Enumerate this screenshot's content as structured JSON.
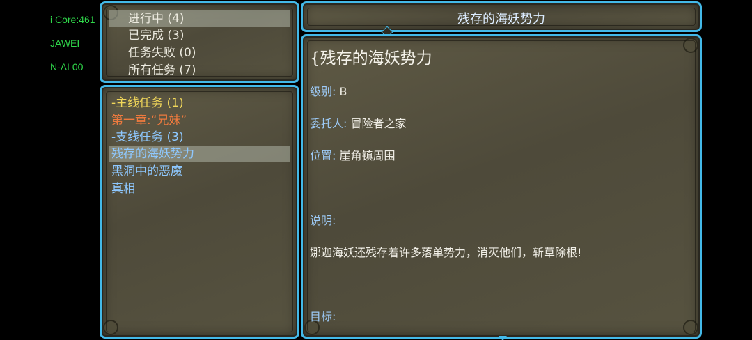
{
  "debug": {
    "line1": "i Core:461",
    "line2": "JAWEI",
    "line3": "N-AL00"
  },
  "filters": [
    {
      "label": "进行中 (4)",
      "selected": true
    },
    {
      "label": "已完成 (3)",
      "selected": false
    },
    {
      "label": "任务失败 (0)",
      "selected": false
    },
    {
      "label": "所有任务 (7)",
      "selected": false
    }
  ],
  "quest_list": [
    {
      "label": "-主线任务 (1)",
      "style": "yellow"
    },
    {
      "label": "第一章:“兄妹”",
      "style": "orange"
    },
    {
      "label": "-支线任务 (3)",
      "style": "blue"
    },
    {
      "label": "残存的海妖势力",
      "style": "blue",
      "selected": true
    },
    {
      "label": "黑洞中的恶魔",
      "style": "blue"
    },
    {
      "label": "真相",
      "style": "blue"
    }
  ],
  "detail": {
    "header_title": "残存的海妖势力",
    "title": "{残存的海妖势力",
    "level_label": "级别:",
    "level_value": " B",
    "client_label": "委托人:",
    "client_value": " 冒险者之家",
    "location_label": "位置:",
    "location_value": " 崖角镇周围",
    "desc_label": "说明:",
    "desc_text": "娜迦海妖还残存着许多落单势力，消灭他们，斩草除根!",
    "goal_label": "目标:"
  }
}
